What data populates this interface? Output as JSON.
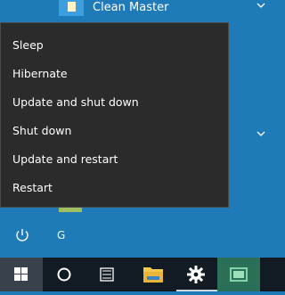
{
  "start_menu": {
    "top_app": {
      "label": "Clean Master",
      "icon": "clean-master-icon"
    },
    "letter_header": "G",
    "power_icon": "power-icon"
  },
  "power_menu": {
    "items": [
      "Sleep",
      "Hibernate",
      "Update and shut down",
      "Shut down",
      "Update and restart",
      "Restart"
    ]
  },
  "taskbar": {
    "buttons": [
      {
        "name": "start-button",
        "icon": "windows-logo-icon"
      },
      {
        "name": "search-button",
        "icon": "cortana-circle-icon"
      },
      {
        "name": "task-view-button",
        "icon": "task-view-icon"
      },
      {
        "name": "file-explorer-button",
        "icon": "folder-icon"
      },
      {
        "name": "settings-button",
        "icon": "gear-icon"
      },
      {
        "name": "store-button",
        "icon": "store-icon"
      }
    ]
  },
  "colors": {
    "start_background": "#1f7ab8",
    "menu_background": "#2b2b2b",
    "taskbar_background": "#121b24",
    "text": "#ffffff"
  }
}
